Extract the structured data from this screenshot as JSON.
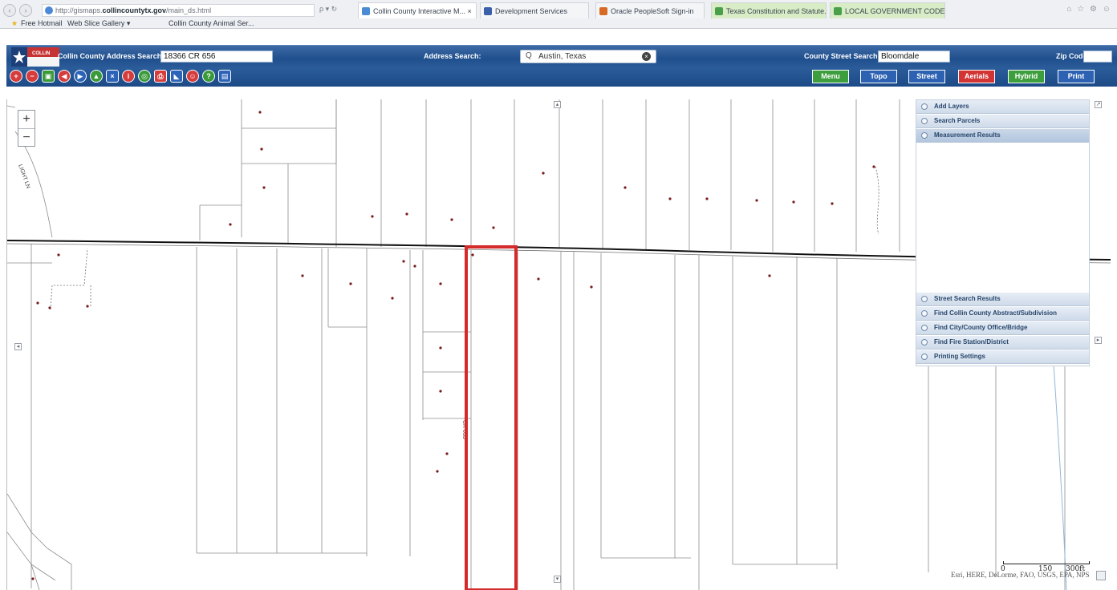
{
  "browser": {
    "back_glyph": "‹",
    "forward_glyph": "›",
    "url_prefix": "http://gismaps.",
    "url_domain": "collincountytx.gov",
    "url_suffix": "/main_ds.html",
    "url_actions": "ρ ▾ ↻",
    "tabs": [
      {
        "label": "Collin County Interactive M... ×",
        "color": "#4a8bd6"
      },
      {
        "label": "Development Services",
        "color": "#3b5fa8"
      },
      {
        "label": "Oracle PeopleSoft Sign-in",
        "color": "#d76b26"
      },
      {
        "label": "Texas Constitution and Statute...",
        "color": "#4aa04a"
      },
      {
        "label": "LOCAL GOVERNMENT CODE ...",
        "color": "#4aa04a"
      }
    ],
    "window_icons": "⌂ ☆ ⚙ ☺",
    "favorites": [
      {
        "label": "Free Hotmail"
      },
      {
        "label": "Web Slice Gallery ▾"
      },
      {
        "label": "Collin County Animal Ser..."
      }
    ]
  },
  "header": {
    "logo_text": "COLLIN",
    "address_search_label": "Collin County Address Search :",
    "address_search_value": "18366 CR 656",
    "address_search2_label": "Address Search:",
    "search_icon": "Q",
    "search2_value": "Austin, Texas",
    "clear_glyph": "×",
    "street_search_label": "County Street Search:",
    "street_search_value": "Bloomdale",
    "zip_label": "Zip Code:",
    "zip_value": ""
  },
  "toolbar": {
    "tools": [
      {
        "name": "add-tool-icon",
        "glyph": "+",
        "color": "#d63c3c"
      },
      {
        "name": "remove-tool-icon",
        "glyph": "−",
        "color": "#d63c3c"
      },
      {
        "name": "map-tool-icon",
        "glyph": "▣",
        "color": "#3a9a3a"
      },
      {
        "name": "back-extent-icon",
        "glyph": "◀",
        "color": "#d63c3c"
      },
      {
        "name": "forward-extent-icon",
        "glyph": "▶",
        "color": "#2c63b8"
      },
      {
        "name": "home-icon",
        "glyph": "▲",
        "color": "#3a9a3a"
      },
      {
        "name": "close-tool-icon",
        "glyph": "×",
        "color": "#2c63b8"
      },
      {
        "name": "info-icon",
        "glyph": "i",
        "color": "#d63c3c"
      },
      {
        "name": "zoom-tool-icon",
        "glyph": "◎",
        "color": "#3a9a3a"
      },
      {
        "name": "print-tool-icon",
        "glyph": "⎙",
        "color": "#d63c3c"
      },
      {
        "name": "measure-icon",
        "glyph": "◣",
        "color": "#2c63b8"
      },
      {
        "name": "user-icon",
        "glyph": "☺",
        "color": "#d63c3c"
      },
      {
        "name": "help-icon",
        "glyph": "?",
        "color": "#3a9a3a"
      },
      {
        "name": "message-icon",
        "glyph": "▤",
        "color": "#2c63b8"
      }
    ],
    "map_buttons": [
      {
        "label": "Menu",
        "color": "#3d9e3d"
      },
      {
        "label": "Topo",
        "color": "#2d62b3"
      },
      {
        "label": "Street",
        "color": "#2d62b3"
      },
      {
        "label": "Aerials",
        "color": "#d23434"
      },
      {
        "label": "Hybrid",
        "color": "#3d9e3d"
      },
      {
        "label": "Print",
        "color": "#2d62b3"
      }
    ]
  },
  "map": {
    "zoom_in": "+",
    "zoom_out": "−",
    "road_labels": [
      "LIGHT LN",
      "CR 655"
    ]
  },
  "panel": {
    "items": [
      {
        "label": "Add Layers"
      },
      {
        "label": "Search Parcels"
      },
      {
        "label": "Measurement Results"
      },
      {
        "label": "Street Search Results"
      },
      {
        "label": "Find Collin County Abstract/Subdivision"
      },
      {
        "label": "Find City/County Office/Bridge"
      },
      {
        "label": "Find Fire Station/District"
      },
      {
        "label": "Printing Settings"
      }
    ]
  },
  "scale": {
    "zero": "0",
    "mid": "150",
    "end": "300ft"
  },
  "attribution": "Esri, HERE, DeLorme, FAO, USGS, EPA, NPS"
}
